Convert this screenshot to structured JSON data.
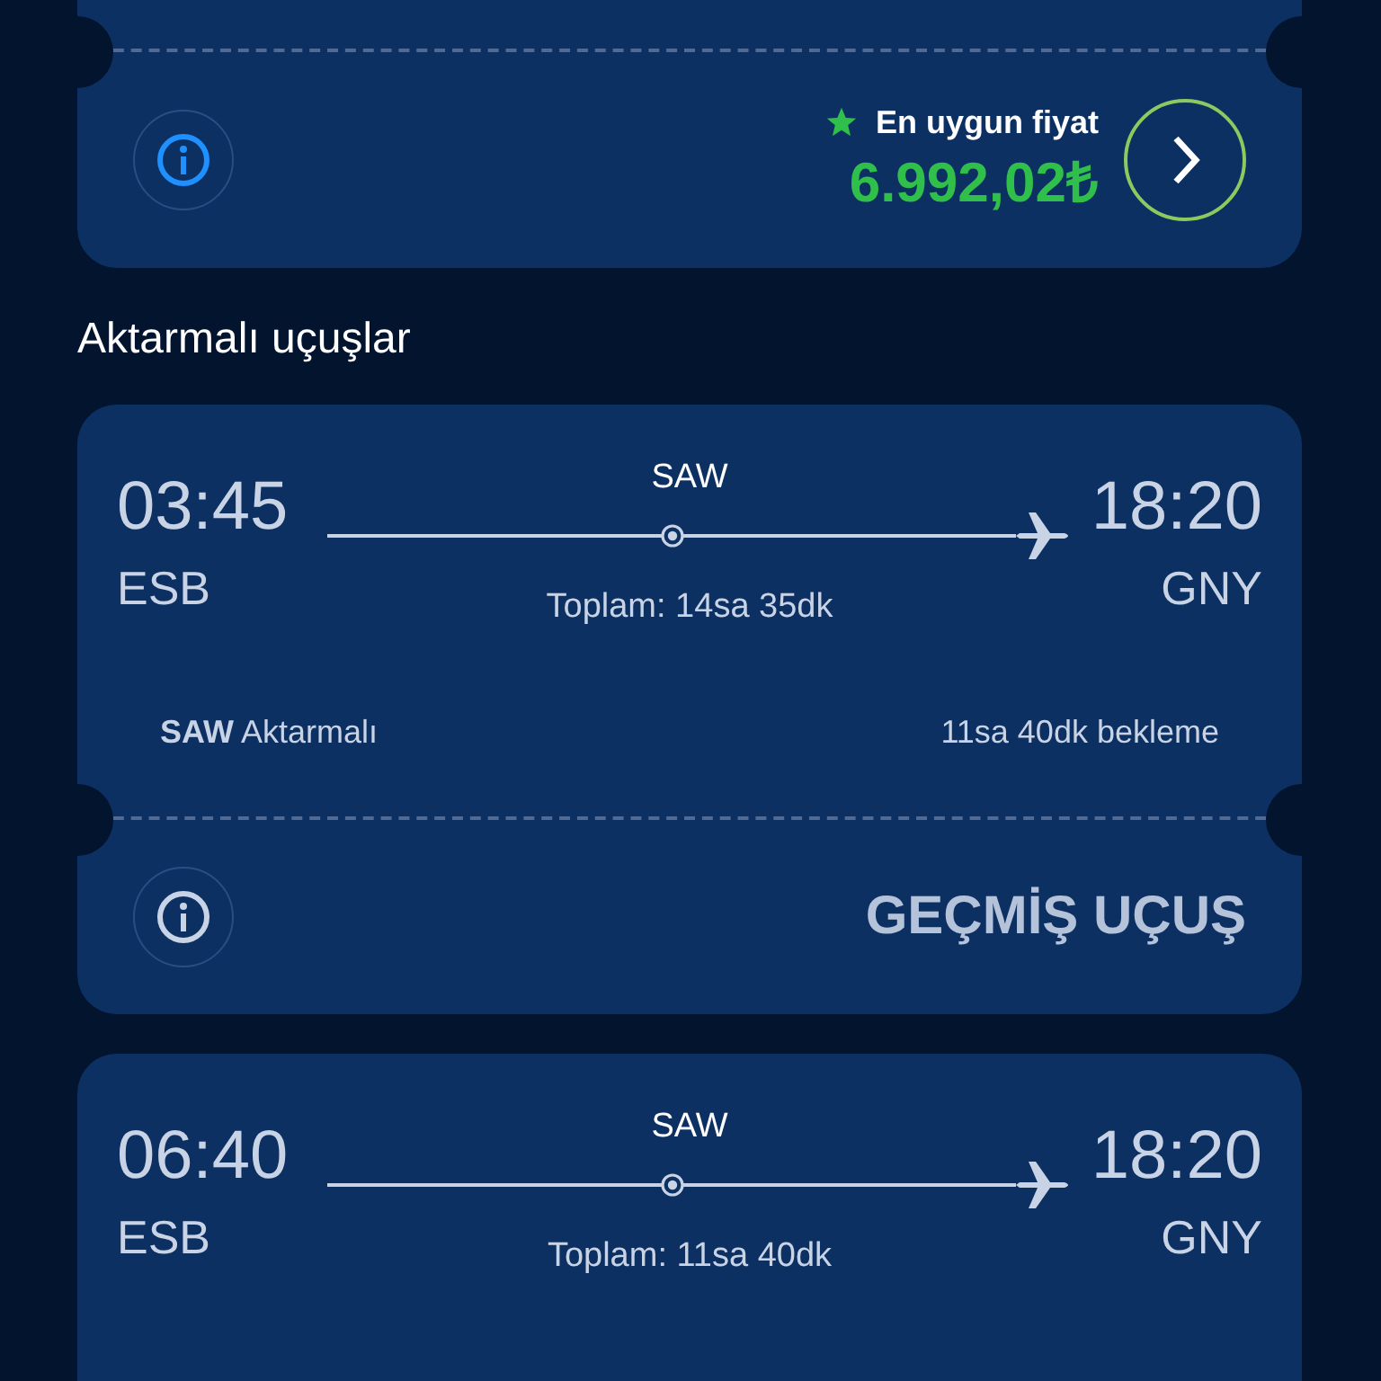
{
  "top_card": {
    "best_price": {
      "label": "En uygun fiyat",
      "price": "6.992,02₺"
    }
  },
  "section_title": "Aktarmalı uçuşlar",
  "flights": [
    {
      "departure_time": "03:45",
      "departure_airport": "ESB",
      "stop": "SAW",
      "total": "Toplam: 14sa 35dk",
      "arrival_time": "18:20",
      "arrival_airport": "GNY",
      "layover": "**SAW** Aktarmalı",
      "wait": "11sa 40dk bekleme",
      "past": true,
      "status": "GEÇMİŞ UÇUŞ"
    },
    {
      "departure_time": "06:40",
      "departure_airport": "ESB",
      "stop": "SAW",
      "total": "Toplam: 11sa 40dk",
      "arrival_time": "18:20",
      "arrival_airport": "GNY"
    }
  ]
}
